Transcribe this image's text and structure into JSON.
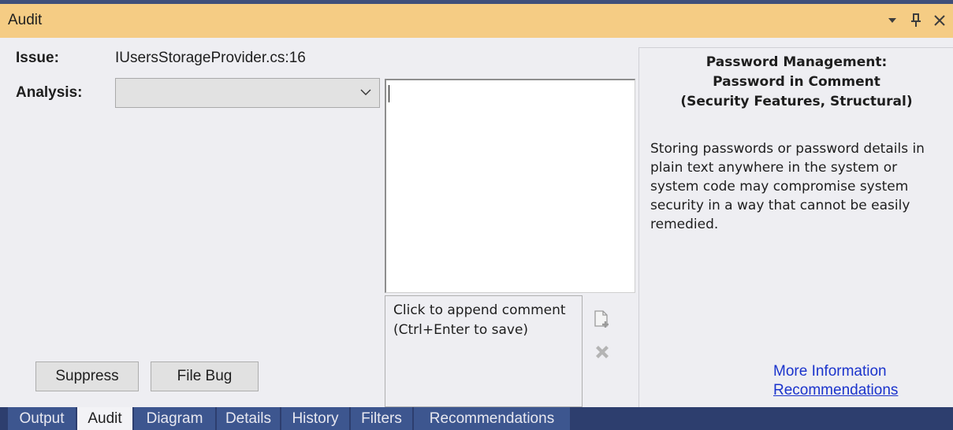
{
  "window": {
    "title": "Audit"
  },
  "title_icons": {
    "dropdown": "▾",
    "pin": "⊥",
    "close": "✕"
  },
  "issue": {
    "label": "Issue:",
    "value": "IUsersStorageProvider.cs:16"
  },
  "analysis": {
    "label": "Analysis:",
    "selected": ""
  },
  "comment": {
    "current_text": "",
    "append_placeholder": "Click to append comment (Ctrl+Enter to save)"
  },
  "buttons": {
    "suppress": "Suppress",
    "file_bug": "File Bug"
  },
  "issue_info": {
    "title_lines": [
      "Password Management:",
      "Password in Comment",
      "(Security Features, Structural)"
    ],
    "description": "Storing passwords or password details in plain text anywhere in the system or system code may compromise system security in a way that cannot be easily remedied.",
    "links": {
      "more_info": "More Information",
      "recommendations": "Recommendations"
    }
  },
  "tabs": [
    {
      "label": "Output",
      "selected": false
    },
    {
      "label": "Audit",
      "selected": true
    },
    {
      "label": "Diagram",
      "selected": false
    },
    {
      "label": "Details",
      "selected": false
    },
    {
      "label": "History",
      "selected": false
    },
    {
      "label": "Filters",
      "selected": false
    },
    {
      "label": "Recommendations",
      "selected": false
    }
  ],
  "colors": {
    "title_bar": "#f5cc84",
    "tab_bar": "#2d3e6e",
    "tab_inactive": "#3d568f",
    "tab_active": "#f3f3f6",
    "link": "#1a33cc"
  }
}
